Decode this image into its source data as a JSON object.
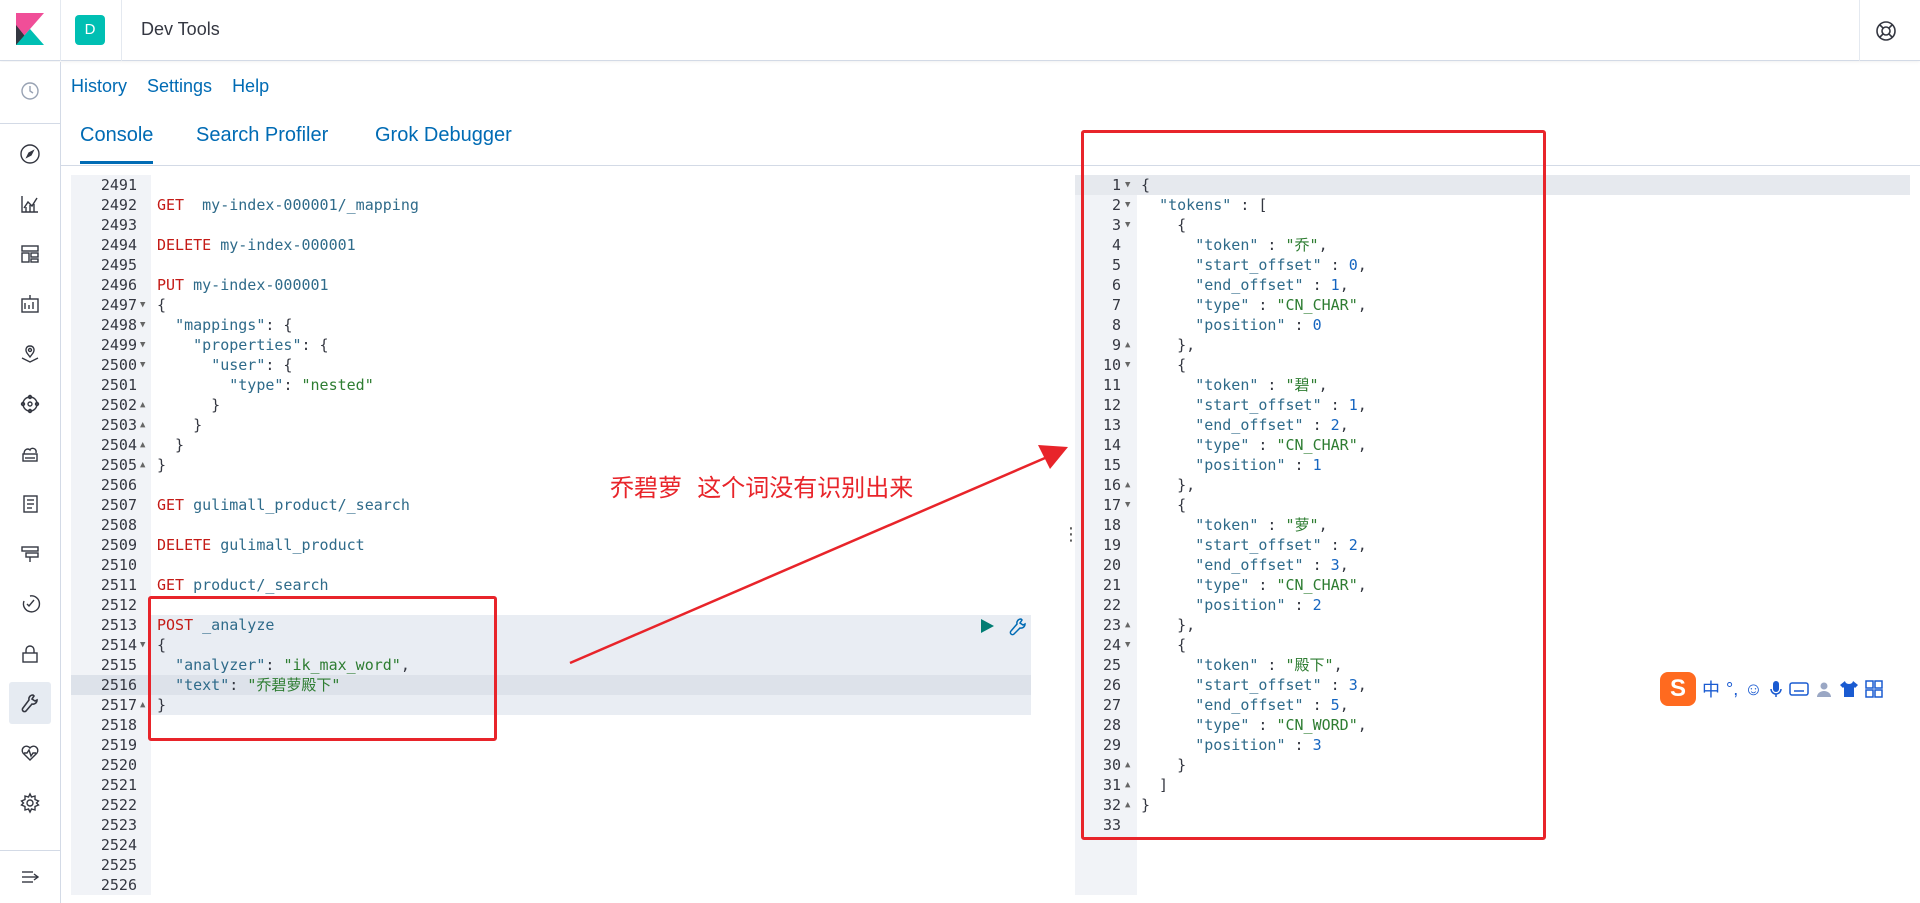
{
  "header": {
    "space_initial": "D",
    "app_title": "Dev Tools"
  },
  "subnav": {
    "items": [
      "History",
      "Settings",
      "Help"
    ]
  },
  "tabs": [
    "Console",
    "Search Profiler",
    "Grok Debugger"
  ],
  "request_editor": {
    "lines": [
      {
        "n": "2491",
        "segs": []
      },
      {
        "n": "2492",
        "segs": [
          [
            "method",
            "GET"
          ],
          [
            "punc",
            "  "
          ],
          [
            "url",
            "my-index-000001/_mapping"
          ]
        ]
      },
      {
        "n": "2493",
        "segs": []
      },
      {
        "n": "2494",
        "segs": [
          [
            "method",
            "DELETE"
          ],
          [
            "punc",
            " "
          ],
          [
            "url",
            "my-index-000001"
          ]
        ]
      },
      {
        "n": "2495",
        "segs": []
      },
      {
        "n": "2496",
        "segs": [
          [
            "method",
            "PUT"
          ],
          [
            "punc",
            " "
          ],
          [
            "url",
            "my-index-000001"
          ]
        ]
      },
      {
        "n": "2497",
        "fold": "down",
        "segs": [
          [
            "punc",
            "{"
          ]
        ]
      },
      {
        "n": "2498",
        "fold": "down",
        "segs": [
          [
            "punc",
            "  "
          ],
          [
            "key",
            "\"mappings\""
          ],
          [
            "punc",
            ": {"
          ]
        ]
      },
      {
        "n": "2499",
        "fold": "down",
        "segs": [
          [
            "punc",
            "    "
          ],
          [
            "key",
            "\"properties\""
          ],
          [
            "punc",
            ": {"
          ]
        ]
      },
      {
        "n": "2500",
        "fold": "down",
        "segs": [
          [
            "punc",
            "      "
          ],
          [
            "key",
            "\"user\""
          ],
          [
            "punc",
            ": {"
          ]
        ]
      },
      {
        "n": "2501",
        "segs": [
          [
            "punc",
            "        "
          ],
          [
            "key",
            "\"type\""
          ],
          [
            "punc",
            ": "
          ],
          [
            "str",
            "\"nested\""
          ]
        ]
      },
      {
        "n": "2502",
        "fold": "up",
        "segs": [
          [
            "punc",
            "      }"
          ]
        ]
      },
      {
        "n": "2503",
        "fold": "up",
        "segs": [
          [
            "punc",
            "    }"
          ]
        ]
      },
      {
        "n": "2504",
        "fold": "up",
        "segs": [
          [
            "punc",
            "  }"
          ]
        ]
      },
      {
        "n": "2505",
        "fold": "up",
        "segs": [
          [
            "punc",
            "}"
          ]
        ]
      },
      {
        "n": "2506",
        "segs": []
      },
      {
        "n": "2507",
        "segs": [
          [
            "method",
            "GET"
          ],
          [
            "punc",
            " "
          ],
          [
            "url",
            "gulimall_product/_search"
          ]
        ]
      },
      {
        "n": "2508",
        "segs": []
      },
      {
        "n": "2509",
        "segs": [
          [
            "method",
            "DELETE"
          ],
          [
            "punc",
            " "
          ],
          [
            "url",
            "gulimall_product"
          ]
        ]
      },
      {
        "n": "2510",
        "segs": []
      },
      {
        "n": "2511",
        "segs": [
          [
            "method",
            "GET"
          ],
          [
            "punc",
            " "
          ],
          [
            "url",
            "product/_search"
          ]
        ]
      },
      {
        "n": "2512",
        "segs": []
      },
      {
        "n": "2513",
        "segs": [
          [
            "method",
            "POST"
          ],
          [
            "punc",
            " "
          ],
          [
            "url",
            "_analyze"
          ]
        ]
      },
      {
        "n": "2514",
        "fold": "down",
        "segs": [
          [
            "punc",
            "{"
          ]
        ]
      },
      {
        "n": "2515",
        "segs": [
          [
            "punc",
            "  "
          ],
          [
            "key",
            "\"analyzer\""
          ],
          [
            "punc",
            ": "
          ],
          [
            "str",
            "\"ik_max_word\""
          ],
          [
            "punc",
            ","
          ]
        ]
      },
      {
        "n": "2516",
        "segs": [
          [
            "punc",
            "  "
          ],
          [
            "key",
            "\"text\""
          ],
          [
            "punc",
            ": "
          ],
          [
            "str",
            "\"乔碧萝殿下\""
          ]
        ]
      },
      {
        "n": "2517",
        "fold": "up",
        "segs": [
          [
            "punc",
            "}"
          ]
        ]
      },
      {
        "n": "2518",
        "segs": []
      },
      {
        "n": "2519",
        "segs": []
      },
      {
        "n": "2520",
        "segs": []
      },
      {
        "n": "2521",
        "segs": []
      },
      {
        "n": "2522",
        "segs": []
      },
      {
        "n": "2523",
        "segs": []
      },
      {
        "n": "2524",
        "segs": []
      },
      {
        "n": "2525",
        "segs": []
      },
      {
        "n": "2526",
        "segs": []
      }
    ]
  },
  "response_editor": {
    "lines": [
      {
        "n": "1",
        "fold": "down",
        "segs": [
          [
            "punc",
            "{"
          ]
        ]
      },
      {
        "n": "2",
        "fold": "down",
        "segs": [
          [
            "punc",
            "  "
          ],
          [
            "key",
            "\"tokens\""
          ],
          [
            "punc",
            " : ["
          ]
        ]
      },
      {
        "n": "3",
        "fold": "down",
        "segs": [
          [
            "punc",
            "    {"
          ]
        ]
      },
      {
        "n": "4",
        "segs": [
          [
            "punc",
            "      "
          ],
          [
            "key",
            "\"token\""
          ],
          [
            "punc",
            " : "
          ],
          [
            "str",
            "\"乔\""
          ],
          [
            "punc",
            ","
          ]
        ]
      },
      {
        "n": "5",
        "segs": [
          [
            "punc",
            "      "
          ],
          [
            "key",
            "\"start_offset\""
          ],
          [
            "punc",
            " : "
          ],
          [
            "num",
            "0"
          ],
          [
            "punc",
            ","
          ]
        ]
      },
      {
        "n": "6",
        "segs": [
          [
            "punc",
            "      "
          ],
          [
            "key",
            "\"end_offset\""
          ],
          [
            "punc",
            " : "
          ],
          [
            "num",
            "1"
          ],
          [
            "punc",
            ","
          ]
        ]
      },
      {
        "n": "7",
        "segs": [
          [
            "punc",
            "      "
          ],
          [
            "key",
            "\"type\""
          ],
          [
            "punc",
            " : "
          ],
          [
            "str",
            "\"CN_CHAR\""
          ],
          [
            "punc",
            ","
          ]
        ]
      },
      {
        "n": "8",
        "segs": [
          [
            "punc",
            "      "
          ],
          [
            "key",
            "\"position\""
          ],
          [
            "punc",
            " : "
          ],
          [
            "num",
            "0"
          ]
        ]
      },
      {
        "n": "9",
        "fold": "up",
        "segs": [
          [
            "punc",
            "    },"
          ]
        ]
      },
      {
        "n": "10",
        "fold": "down",
        "segs": [
          [
            "punc",
            "    {"
          ]
        ]
      },
      {
        "n": "11",
        "segs": [
          [
            "punc",
            "      "
          ],
          [
            "key",
            "\"token\""
          ],
          [
            "punc",
            " : "
          ],
          [
            "str",
            "\"碧\""
          ],
          [
            "punc",
            ","
          ]
        ]
      },
      {
        "n": "12",
        "segs": [
          [
            "punc",
            "      "
          ],
          [
            "key",
            "\"start_offset\""
          ],
          [
            "punc",
            " : "
          ],
          [
            "num",
            "1"
          ],
          [
            "punc",
            ","
          ]
        ]
      },
      {
        "n": "13",
        "segs": [
          [
            "punc",
            "      "
          ],
          [
            "key",
            "\"end_offset\""
          ],
          [
            "punc",
            " : "
          ],
          [
            "num",
            "2"
          ],
          [
            "punc",
            ","
          ]
        ]
      },
      {
        "n": "14",
        "segs": [
          [
            "punc",
            "      "
          ],
          [
            "key",
            "\"type\""
          ],
          [
            "punc",
            " : "
          ],
          [
            "str",
            "\"CN_CHAR\""
          ],
          [
            "punc",
            ","
          ]
        ]
      },
      {
        "n": "15",
        "segs": [
          [
            "punc",
            "      "
          ],
          [
            "key",
            "\"position\""
          ],
          [
            "punc",
            " : "
          ],
          [
            "num",
            "1"
          ]
        ]
      },
      {
        "n": "16",
        "fold": "up",
        "segs": [
          [
            "punc",
            "    },"
          ]
        ]
      },
      {
        "n": "17",
        "fold": "down",
        "segs": [
          [
            "punc",
            "    {"
          ]
        ]
      },
      {
        "n": "18",
        "segs": [
          [
            "punc",
            "      "
          ],
          [
            "key",
            "\"token\""
          ],
          [
            "punc",
            " : "
          ],
          [
            "str",
            "\"萝\""
          ],
          [
            "punc",
            ","
          ]
        ]
      },
      {
        "n": "19",
        "segs": [
          [
            "punc",
            "      "
          ],
          [
            "key",
            "\"start_offset\""
          ],
          [
            "punc",
            " : "
          ],
          [
            "num",
            "2"
          ],
          [
            "punc",
            ","
          ]
        ]
      },
      {
        "n": "20",
        "segs": [
          [
            "punc",
            "      "
          ],
          [
            "key",
            "\"end_offset\""
          ],
          [
            "punc",
            " : "
          ],
          [
            "num",
            "3"
          ],
          [
            "punc",
            ","
          ]
        ]
      },
      {
        "n": "21",
        "segs": [
          [
            "punc",
            "      "
          ],
          [
            "key",
            "\"type\""
          ],
          [
            "punc",
            " : "
          ],
          [
            "str",
            "\"CN_CHAR\""
          ],
          [
            "punc",
            ","
          ]
        ]
      },
      {
        "n": "22",
        "segs": [
          [
            "punc",
            "      "
          ],
          [
            "key",
            "\"position\""
          ],
          [
            "punc",
            " : "
          ],
          [
            "num",
            "2"
          ]
        ]
      },
      {
        "n": "23",
        "fold": "up",
        "segs": [
          [
            "punc",
            "    },"
          ]
        ]
      },
      {
        "n": "24",
        "fold": "down",
        "segs": [
          [
            "punc",
            "    {"
          ]
        ]
      },
      {
        "n": "25",
        "segs": [
          [
            "punc",
            "      "
          ],
          [
            "key",
            "\"token\""
          ],
          [
            "punc",
            " : "
          ],
          [
            "str",
            "\"殿下\""
          ],
          [
            "punc",
            ","
          ]
        ]
      },
      {
        "n": "26",
        "segs": [
          [
            "punc",
            "      "
          ],
          [
            "key",
            "\"start_offset\""
          ],
          [
            "punc",
            " : "
          ],
          [
            "num",
            "3"
          ],
          [
            "punc",
            ","
          ]
        ]
      },
      {
        "n": "27",
        "segs": [
          [
            "punc",
            "      "
          ],
          [
            "key",
            "\"end_offset\""
          ],
          [
            "punc",
            " : "
          ],
          [
            "num",
            "5"
          ],
          [
            "punc",
            ","
          ]
        ]
      },
      {
        "n": "28",
        "segs": [
          [
            "punc",
            "      "
          ],
          [
            "key",
            "\"type\""
          ],
          [
            "punc",
            " : "
          ],
          [
            "str",
            "\"CN_WORD\""
          ],
          [
            "punc",
            ","
          ]
        ]
      },
      {
        "n": "29",
        "segs": [
          [
            "punc",
            "      "
          ],
          [
            "key",
            "\"position\""
          ],
          [
            "punc",
            " : "
          ],
          [
            "num",
            "3"
          ]
        ]
      },
      {
        "n": "30",
        "fold": "up",
        "segs": [
          [
            "punc",
            "    }"
          ]
        ]
      },
      {
        "n": "31",
        "fold": "up",
        "segs": [
          [
            "punc",
            "  ]"
          ]
        ]
      },
      {
        "n": "32",
        "fold": "up",
        "segs": [
          [
            "punc",
            "}"
          ]
        ]
      },
      {
        "n": "33",
        "segs": []
      }
    ]
  },
  "annotation": {
    "text": "乔碧萝  这个词没有识别出来"
  },
  "ime": {
    "chinese_mode": "中",
    "punct": "°,"
  },
  "colors": {
    "accent": "#006bb4",
    "annotation_red": "#e8242a",
    "run_green": "#017d73"
  }
}
